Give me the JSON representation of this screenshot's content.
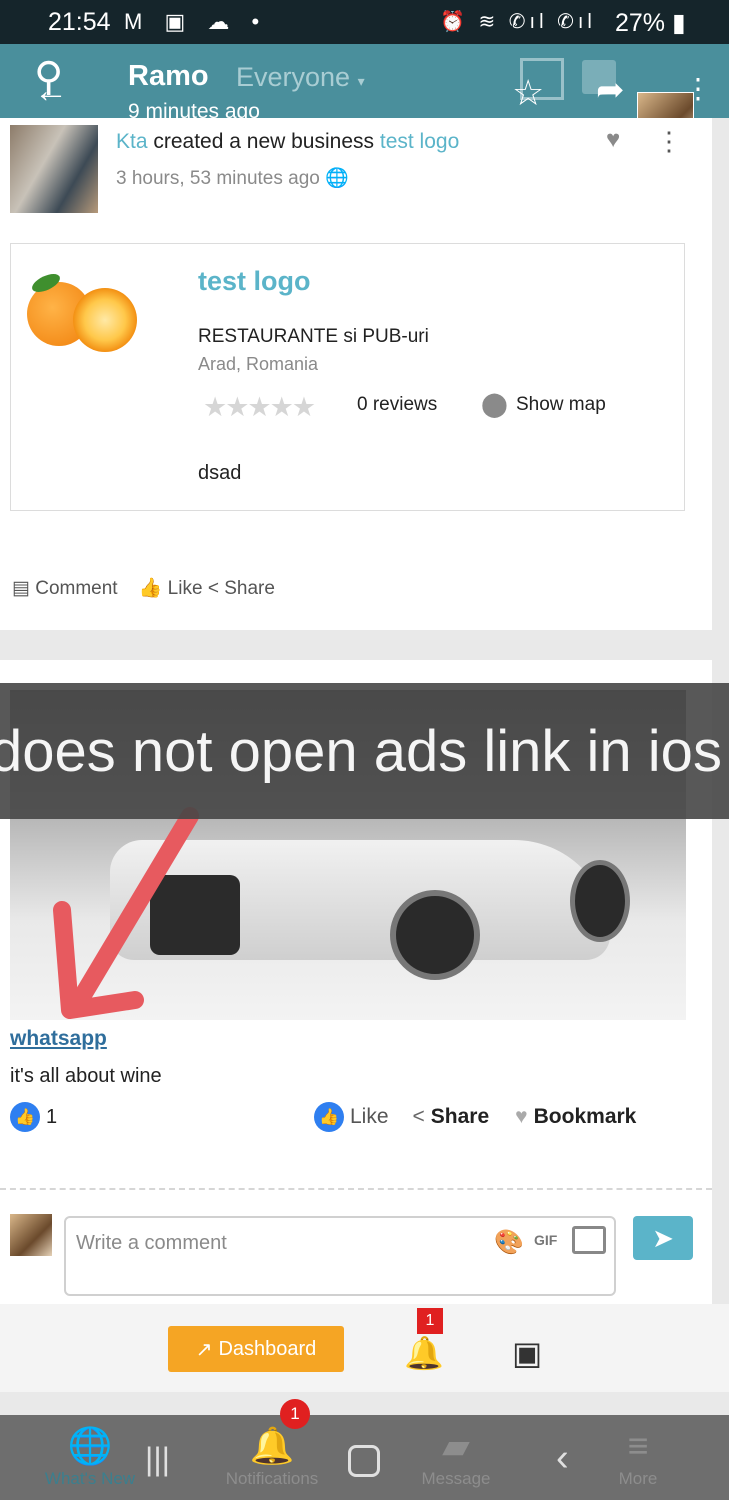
{
  "status_bar": {
    "time": "21:54",
    "battery": "27%"
  },
  "header": {
    "name": "Ramo",
    "audience": "Everyone",
    "time_ago": "9 minutes ago"
  },
  "post1": {
    "author": "Kta",
    "action_text": "created a new business",
    "business_link": "test logo",
    "timestamp": "3 hours, 53 minutes ago",
    "business": {
      "title": "test logo",
      "category": "RESTAURANTE si PUB-uri",
      "location": "Arad, Romania",
      "reviews": "0 reviews",
      "show_map": "Show map",
      "description": "dsad"
    },
    "actions": {
      "comment": "Comment",
      "like": "Like",
      "share": "Share"
    }
  },
  "overlay_text": "does not open ads link in ios",
  "post2": {
    "link": "whatsapp",
    "caption": "it's all about wine",
    "like_count": "1",
    "actions": {
      "like": "Like",
      "share": "Share",
      "bookmark": "Bookmark"
    },
    "comment_placeholder": "Write a comment",
    "gif_label": "GIF"
  },
  "bottom_bar": {
    "dashboard": "Dashboard",
    "notif_count": "1"
  },
  "nav": {
    "whats_new": "What's New",
    "notifications": "Notifications",
    "notif_badge": "1",
    "message": "Message",
    "more": "More"
  }
}
